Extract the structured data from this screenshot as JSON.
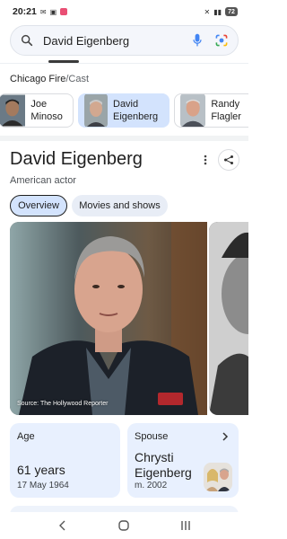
{
  "status_bar": {
    "time": "20:21",
    "left_icons": [
      "gmail-icon",
      "calendar-icon",
      "app-notification-icon"
    ],
    "right_text": "⁴ᴳ",
    "battery": "72"
  },
  "search": {
    "query": "David Eigenberg"
  },
  "breadcrumb": {
    "parent": "Chicago Fire",
    "separator": "/",
    "current": "Cast"
  },
  "cast": [
    {
      "name": "Joe Minoso"
    },
    {
      "name": "David Eigenberg",
      "selected": true
    },
    {
      "name": "Randy Flagler"
    }
  ],
  "entity": {
    "name": "David Eigenberg",
    "description": "American actor"
  },
  "tabs": [
    {
      "label": "Overview",
      "active": true
    },
    {
      "label": "Movies and shows"
    }
  ],
  "image": {
    "caption": "Source: The Hollywood Reporter"
  },
  "cards": {
    "age": {
      "label": "Age",
      "value": "61 years",
      "sub": "17 May 1964"
    },
    "spouse": {
      "label": "Spouse",
      "value": "Chrysti Eigenberg",
      "sub": "m. 2002"
    }
  },
  "colors": {
    "accent": "#d3e3fd",
    "card_bg": "#e8f0fe",
    "mic": "#4285f4"
  }
}
